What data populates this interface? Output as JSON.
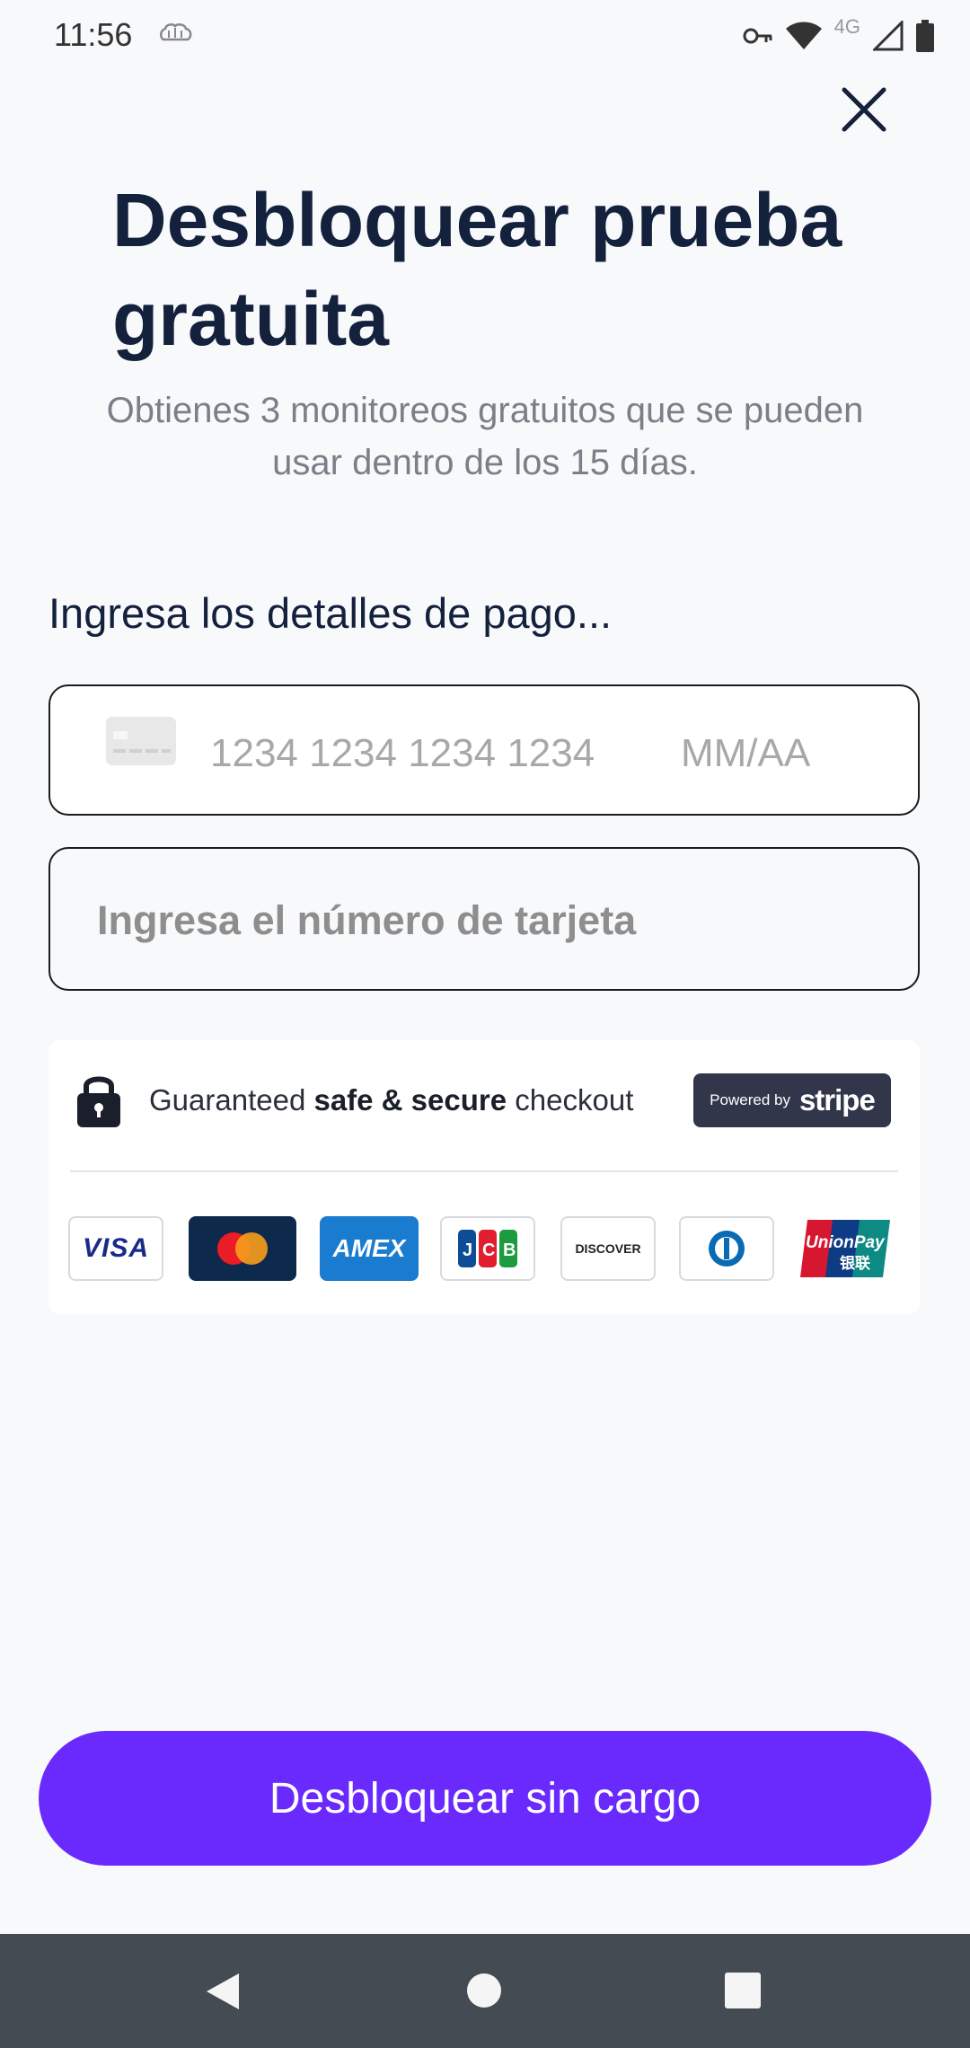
{
  "status_bar": {
    "time": "11:56",
    "network": "4G",
    "icons": [
      "brain-icon",
      "vpn-key-icon",
      "wifi-icon",
      "signal-icon",
      "battery-icon"
    ]
  },
  "header": {
    "close_icon": "close-icon"
  },
  "main": {
    "title": "Desbloquear prueba gratuita",
    "subtitle": "Obtienes 3 monitoreos gratuitos que se pueden usar dentro de los 15 días.",
    "section_label": "Ingresa los detalles de pago...",
    "card_row": {
      "number_placeholder": "1234 1234 1234 1234",
      "expiry_placeholder": "MM/AA"
    },
    "card_number_field": {
      "placeholder": "Ingresa el número de tarjeta"
    },
    "secure": {
      "text_pre": "Guaranteed ",
      "text_bold": "safe & secure",
      "text_post": " checkout",
      "badge_small": "Powered by",
      "badge_brand": "stripe",
      "logos": [
        "VISA",
        "mastercard",
        "AMEX",
        "JCB",
        "DISCOVER",
        "Diners Club",
        "UnionPay"
      ],
      "unionpay_sub": "银联"
    },
    "cta_label": "Desbloquear sin cargo"
  },
  "colors": {
    "accent": "#6a2afe",
    "title": "#14213d",
    "background": "#f8f9fb",
    "navbar": "#454b53"
  }
}
